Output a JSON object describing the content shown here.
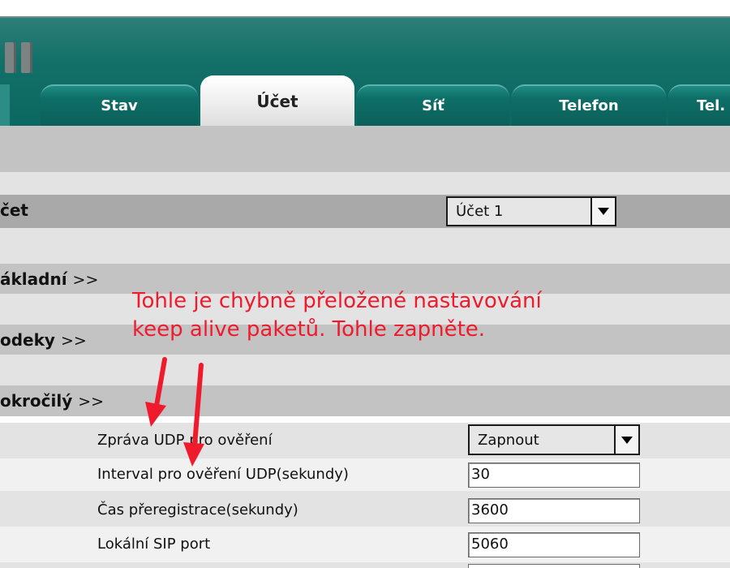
{
  "tabs": [
    {
      "label": "Stav",
      "active": false
    },
    {
      "label": "Účet",
      "active": true
    },
    {
      "label": "Síť",
      "active": false
    },
    {
      "label": "Telefon",
      "active": false
    },
    {
      "label": "Tel. s",
      "active": false
    }
  ],
  "account": {
    "title": "čet",
    "select_value": "Účet 1"
  },
  "sections": {
    "basic": "ákladní",
    "codecs": "odeky",
    "advanced": "okročilý",
    "arrow": ">>"
  },
  "fields": {
    "udp_keepalive": {
      "label": "Zpráva UDP pro ověření",
      "value": "Zapnout"
    },
    "udp_interval": {
      "label": "Interval pro ověření UDP(sekundy)",
      "value": "30"
    },
    "reregistration": {
      "label": "Čas přeregistrace(sekundy)",
      "value": "3600"
    },
    "local_sip_port": {
      "label": "Lokální SIP port",
      "value": "5060"
    }
  },
  "annotation": {
    "line1": "Tohle je chybně přeložené nastavování",
    "line2": "keep alive paketů. Tohle zapněte."
  },
  "colors": {
    "header": "#0b6861",
    "annotation": "#ef1b2d",
    "band_dark": "#c3c3c3",
    "band_light": "#e3e3e3",
    "account_band": "#a9a9a9"
  },
  "icons": {
    "dropdown": "triangle-down",
    "annotation_arrow": "red-arrow-down"
  }
}
